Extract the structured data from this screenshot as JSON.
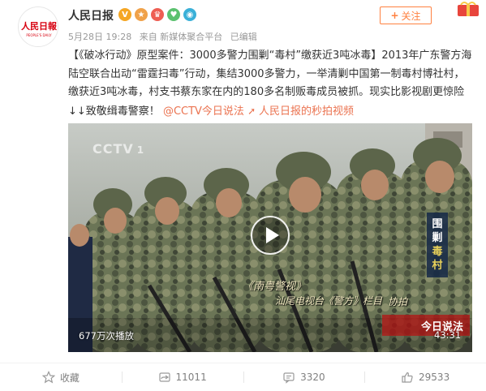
{
  "user": {
    "name": "人民日报",
    "avatar_text": "人民日报",
    "avatar_sub": "PEOPLE'S DAILY",
    "follow_label": "关注"
  },
  "meta": {
    "time": "5月28日 19:28",
    "source": "来自 新媒体聚合平台",
    "edited": "已编辑"
  },
  "post": {
    "p1": "【《破冰行动》原型案件：3000多警力围剿“毒村”缴获近3吨冰毒】2013年广东警方海陆空联合出动“雷霆扫毒”行动，集结3000多警力，一举清剿中国第一制毒村博社村，缴获近3吨冰毒，村支书蔡东家在内的180多名制贩毒成员被抓。现实比影视剧更惊险↓↓致敬缉毒警察！",
    "link1": "@CCTV今日说法",
    "link2": "人民日报的秒拍视频"
  },
  "video": {
    "channel": "CCTV",
    "channel_num": "1",
    "views": "677万次播放",
    "duration": "43:31",
    "subtitle1": "《南粤警视》",
    "subtitle2": "汕尾电视台《警方》栏目",
    "subtitle3": "协拍",
    "program_logo": "今日说法",
    "side_tag_1": "围",
    "side_tag_2": "剿",
    "side_tag_3": "毒",
    "side_tag_4": "村"
  },
  "actions": {
    "favorite": "收藏",
    "repost": "11011",
    "comment": "3320",
    "like": "29533"
  },
  "colors": {
    "accent": "#eb7350",
    "follow": "#ff8140",
    "avatar_red": "#d7000f"
  },
  "icons": [
    "verified-icon",
    "star-icon",
    "heart-icon",
    "camera-icon",
    "link-icon",
    "play-icon",
    "favorite-icon",
    "repost-icon",
    "comment-icon",
    "like-icon"
  ]
}
